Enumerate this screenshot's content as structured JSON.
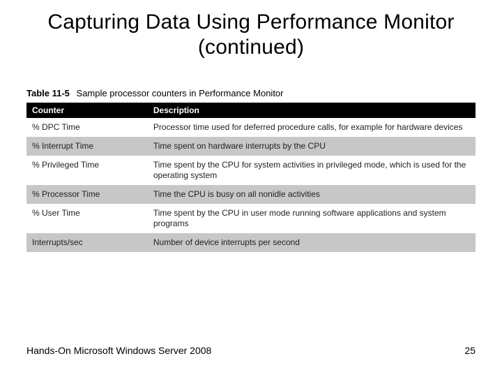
{
  "title": "Capturing Data Using Performance Monitor (continued)",
  "table": {
    "label_number": "Table 11-5",
    "label_caption": "Sample processor counters in Performance Monitor",
    "headers": {
      "counter": "Counter",
      "description": "Description"
    },
    "rows": [
      {
        "counter": "% DPC Time",
        "description": "Processor time used for deferred procedure calls, for example for hardware devices"
      },
      {
        "counter": "% Interrupt Time",
        "description": "Time spent on hardware interrupts by the CPU"
      },
      {
        "counter": "% Privileged Time",
        "description": "Time spent by the CPU for system activities in privileged mode, which is used for the operating system"
      },
      {
        "counter": "% Processor Time",
        "description": "Time the CPU is busy on all nonidle activities"
      },
      {
        "counter": "% User Time",
        "description": "Time spent by the CPU in user mode running software applications and system programs"
      },
      {
        "counter": "Interrupts/sec",
        "description": "Number of device interrupts per second"
      }
    ]
  },
  "footer": {
    "text": "Hands-On Microsoft Windows Server 2008",
    "page": "25"
  }
}
